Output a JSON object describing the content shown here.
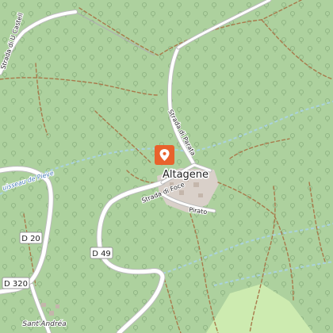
{
  "map": {
    "place_label": "Altagene",
    "hamlet_label": "Sant'Andréa",
    "road_shields": [
      "D 20",
      "D 49",
      "D 320"
    ],
    "street_labels": {
      "castello": "Strada di U Castell",
      "parata": "Strada di Parata",
      "foce": "Strada di Foce",
      "pirato": "Pirato"
    },
    "stream_label": "uisseau de Pieve",
    "marker_icon": "map-pin-icon",
    "colors": {
      "forest": "#add19e",
      "village": "#d9d0c9",
      "road": "#ffffff",
      "track": "#a87a4b",
      "stream": "#aad3df",
      "marker": "#e8622c",
      "meadow": "#cdebb0"
    }
  }
}
